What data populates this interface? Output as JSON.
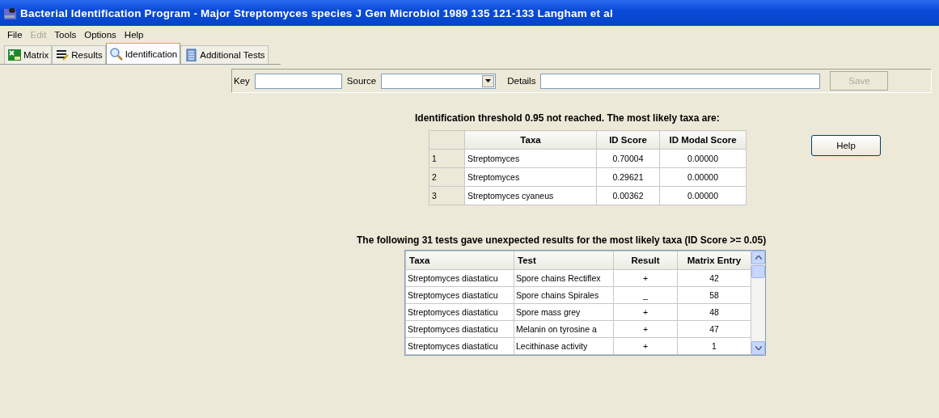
{
  "window": {
    "title": "Bacterial Identification Program - Major Streptomyces species J Gen Microbiol 1989 135 121-133 Langham et al"
  },
  "menu": [
    {
      "label": "File",
      "disabled": false
    },
    {
      "label": "Edit",
      "disabled": true
    },
    {
      "label": "Tools",
      "disabled": false
    },
    {
      "label": "Options",
      "disabled": false
    },
    {
      "label": "Help",
      "disabled": false
    }
  ],
  "tabs": [
    {
      "label": "Matrix",
      "selected": false,
      "kind": "matrix"
    },
    {
      "label": "Results",
      "selected": false,
      "kind": "results"
    },
    {
      "label": "Identification",
      "selected": true,
      "kind": "search"
    },
    {
      "label": "Additional Tests",
      "selected": false,
      "kind": "tests"
    }
  ],
  "toolbar": {
    "key_label": "Key",
    "source_label": "Source",
    "details_label": "Details",
    "save_button": {
      "label": "Save",
      "disabled": true
    }
  },
  "identification": {
    "message": "Identification threshold 0.95 not reached. The most likely taxa are:",
    "columns": [
      "Taxa",
      "ID Score",
      "ID Modal Score"
    ],
    "rows": [
      {
        "index": "1",
        "taxa": "Streptomyces",
        "id_score": "0.70004",
        "modal_score": "0.00000"
      },
      {
        "index": "2",
        "taxa": "Streptomyces",
        "id_score": "0.29621",
        "modal_score": "0.00000"
      },
      {
        "index": "3",
        "taxa": "Streptomyces cyaneus",
        "id_score": "0.00362",
        "modal_score": "0.00000"
      }
    ]
  },
  "help_button": "Help",
  "unexpected": {
    "message": "The following 31 tests gave unexpected results for the most likely taxa (ID Score >= 0.05)",
    "columns": [
      "Taxa",
      "Test",
      "Result",
      "Matrix Entry"
    ],
    "rows": [
      {
        "taxa": "Streptomyces diastaticu",
        "test": "Spore chains Rectiflex",
        "result": "+",
        "matrix_entry": "42"
      },
      {
        "taxa": "Streptomyces diastaticu",
        "test": "Spore chains Spirales",
        "result": "_",
        "matrix_entry": "58"
      },
      {
        "taxa": "Streptomyces diastaticu",
        "test": "Spore mass grey",
        "result": "+",
        "matrix_entry": "48"
      },
      {
        "taxa": "Streptomyces diastaticu",
        "test": "Melanin on tyrosine a",
        "result": "+",
        "matrix_entry": "47"
      },
      {
        "taxa": "Streptomyces diastaticu",
        "test": "Lecithinase activity",
        "result": "+",
        "matrix_entry": "1"
      }
    ]
  }
}
